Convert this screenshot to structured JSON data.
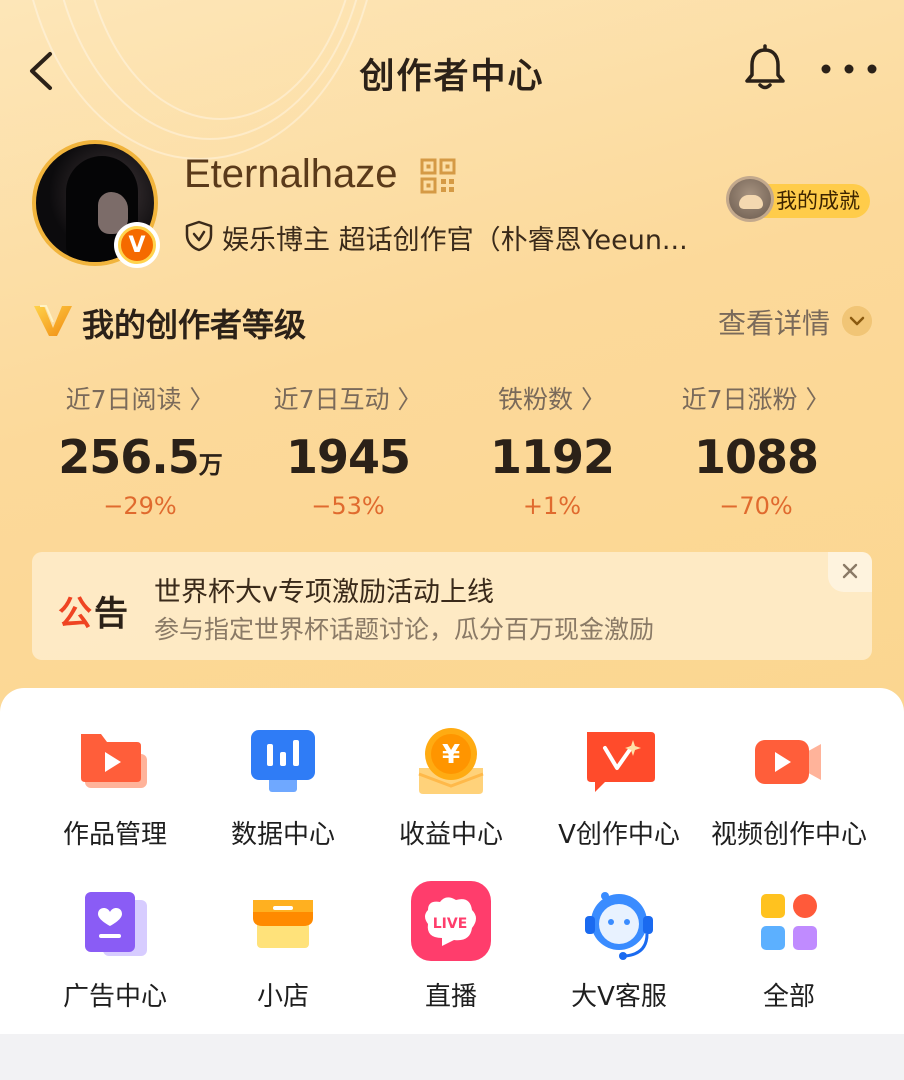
{
  "header": {
    "title": "创作者中心"
  },
  "profile": {
    "username": "Eternalhaze",
    "title": "娱乐博主 超话创作官（朴睿恩Yeeun...",
    "achievement_label": "我的成就",
    "v_badge": "V"
  },
  "level": {
    "title": "我的创作者等级",
    "details_label": "查看详情"
  },
  "stats": [
    {
      "label": "近7日阅读 〉",
      "value": "256.5",
      "unit": "万",
      "change": "−29%"
    },
    {
      "label": "近7日互动 〉",
      "value": "1945",
      "unit": "",
      "change": "−53%"
    },
    {
      "label": "铁粉数 〉",
      "value": "1192",
      "unit": "",
      "change": "+1%"
    },
    {
      "label": "近7日涨粉 〉",
      "value": "1088",
      "unit": "",
      "change": "−70%"
    }
  ],
  "notice": {
    "tag_first": "公",
    "tag_second": "告",
    "title": "世界杯大v专项激励活动上线",
    "description": "参与指定世界杯话题讨论，瓜分百万现金激励"
  },
  "tools": [
    {
      "label": "作品管理",
      "icon": "works-folder-icon"
    },
    {
      "label": "数据中心",
      "icon": "data-chart-icon"
    },
    {
      "label": "收益中心",
      "icon": "income-yen-icon"
    },
    {
      "label": "V创作中心",
      "icon": "v-creation-icon"
    },
    {
      "label": "视频创作中心",
      "icon": "video-camera-icon"
    },
    {
      "label": "广告中心",
      "icon": "ad-heart-icon"
    },
    {
      "label": "小店",
      "icon": "shop-icon"
    },
    {
      "label": "直播",
      "icon": "live-icon"
    },
    {
      "label": "大V客服",
      "icon": "service-headset-icon"
    },
    {
      "label": "全部",
      "icon": "all-apps-icon"
    }
  ],
  "colors": {
    "accent_orange": "#f56a00",
    "change_red": "#e06a2e",
    "background_gold": "#fcd99a"
  }
}
